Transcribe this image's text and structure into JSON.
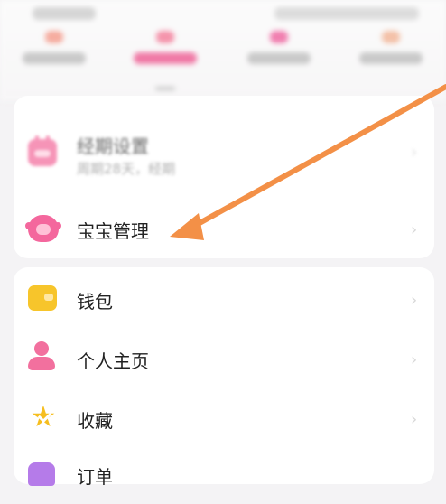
{
  "header": {
    "tabs": [
      {
        "label": "",
        "color": "#f59f8f"
      },
      {
        "label": "",
        "color": "#f3839d",
        "active": true
      },
      {
        "label": "",
        "color": "#ef6aa2"
      },
      {
        "label": "",
        "color": "#f2b79a"
      }
    ]
  },
  "top_card": {
    "items": [
      {
        "icon": "calendar-icon",
        "label": "经期设置",
        "sub": "周期28天，经期"
      },
      {
        "icon": "baby-icon",
        "label": "宝宝管理"
      }
    ]
  },
  "bottom_card": {
    "items": [
      {
        "icon": "wallet-icon",
        "label": "钱包"
      },
      {
        "icon": "person-icon",
        "label": "个人主页"
      },
      {
        "icon": "star-icon",
        "label": "收藏"
      },
      {
        "icon": "order-icon",
        "label": "订单"
      }
    ]
  },
  "overlay": {
    "arrow_color": "#f39047"
  }
}
